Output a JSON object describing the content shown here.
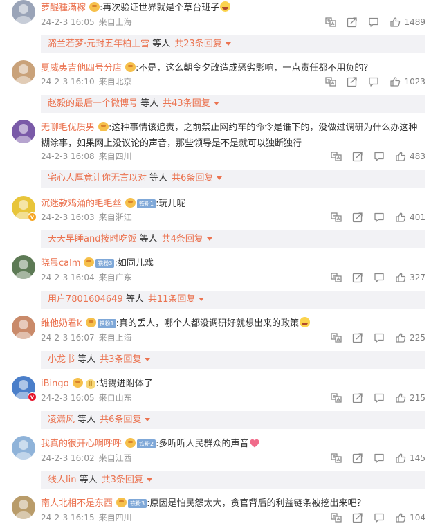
{
  "comments": [
    {
      "username": "萝醍種滿稼",
      "fans": "",
      "vip": "",
      "text": ":再次验证世界就是个草台班子",
      "emoji": "laugh",
      "time": "24-2-3 16:05",
      "location": "来自上海",
      "likes": "1489",
      "reply_name": "潞兰若梦·元封五年柏上雪",
      "reply_mid": "等人",
      "reply_count": "共23条回复",
      "avatar_color": "#9aa4b8",
      "badge": ""
    },
    {
      "username": "夏威夷吉他四号分店",
      "fans": "",
      "vip": "",
      "text": ":不是，这么朝令夕改造成恶劣影响，一点责任都不用负的？",
      "emoji": "",
      "time": "24-2-3 16:10",
      "location": "来自北京",
      "likes": "1023",
      "reply_name": "赵毅的最后一个微博号",
      "reply_mid": "等人",
      "reply_count": "共43条回复",
      "avatar_color": "#c9a27a",
      "badge": ""
    },
    {
      "username": "无聊毛优质男",
      "fans": "",
      "vip": "",
      "text": ":这种事情该追责，之前禁止网约车的命令是谁下的，没做过调研为什么办这种糊涂事，如果网上没议论的声音，那些领导是不是就可以独断独行",
      "emoji": "",
      "time": "24-2-3 16:08",
      "location": "来自四川",
      "likes": "483",
      "reply_name": "宅心人厚竟让你无言以对",
      "reply_mid": "等人",
      "reply_count": "共6条回复",
      "avatar_color": "#7a5aa8",
      "badge": ""
    },
    {
      "username": "沉迷款鸡涌的毛毛丝",
      "fans": "铁粉1",
      "vip": "",
      "text": ":玩儿呢",
      "emoji": "",
      "time": "24-2-3 16:03",
      "location": "来自浙江",
      "likes": "401",
      "reply_name": "天天早睡and按时吃饭",
      "reply_mid": "等人",
      "reply_count": "共4条回复",
      "avatar_color": "#e8c53a",
      "badge": "y"
    },
    {
      "username": "晓晨calm",
      "fans": "铁粉3",
      "vip": "",
      "text": ":如同儿戏",
      "emoji": "",
      "time": "24-2-3 16:04",
      "location": "来自广东",
      "likes": "327",
      "reply_name": "用户7801604649",
      "reply_mid": "等人",
      "reply_count": "共11条回复",
      "avatar_color": "#5d7a55",
      "badge": ""
    },
    {
      "username": "维他奶君k",
      "fans": "铁粉1",
      "vip": "",
      "text": ":真的丢人，哪个人都没调研好就想出来的政策",
      "emoji": "laugh",
      "time": "24-2-3 16:07",
      "location": "来自上海",
      "likes": "225",
      "reply_name": "小龙书",
      "reply_mid": "等人",
      "reply_count": "共3条回复",
      "avatar_color": "#c98a6a",
      "badge": ""
    },
    {
      "username": "iBingo",
      "fans": "",
      "vip": "II",
      "text": ":胡锡进附体了",
      "emoji": "",
      "time": "24-2-3 16:05",
      "location": "来自山东",
      "likes": "215",
      "reply_name": "凌潇风",
      "reply_mid": "等人",
      "reply_count": "共6条回复",
      "avatar_color": "#4a7ec9",
      "badge": "r"
    },
    {
      "username": "我真的很开心啊呼呼",
      "fans": "铁粉2",
      "vip": "",
      "text": ":多听听人民群众的声音",
      "emoji": "heart",
      "time": "24-2-3 16:02",
      "location": "来自江西",
      "likes": "145",
      "reply_name": "线人lin",
      "reply_mid": "等人",
      "reply_count": "共3条回复",
      "avatar_color": "#8fb3d9",
      "badge": ""
    },
    {
      "username": "南人北相不是东西",
      "fans": "铁粉3",
      "vip": "",
      "text": ":原因是怕民怨太大，贪官背后的利益链条被挖出来吧？",
      "emoji": "",
      "time": "24-2-3 16:15",
      "location": "来自四川",
      "likes": "104",
      "reply_name": "",
      "reply_mid": "",
      "reply_count": "",
      "avatar_color": "#b99c6a",
      "badge": ""
    }
  ]
}
